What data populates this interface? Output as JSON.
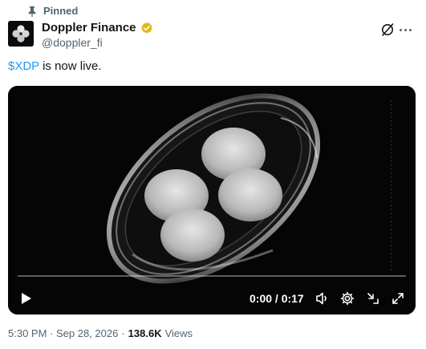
{
  "pinned_label": "Pinned",
  "author": {
    "display_name": "Doppler Finance",
    "handle": "@doppler_fi",
    "verified_badge_color": "#e2b719"
  },
  "tweet": {
    "cashtag": "$XDP",
    "text_rest": " is now live."
  },
  "video": {
    "time_display": "0:00 / 0:17",
    "progress": 0.0
  },
  "footer": {
    "timestamp": "5:30 PM · Sep 28, 2026",
    "separator": "·",
    "views_count": "138.6K",
    "views_label": "Views"
  },
  "colors": {
    "accent": "#1d9bf0",
    "muted": "#536471"
  },
  "icons": [
    "pin-icon",
    "verified-badge-icon",
    "grok-icon",
    "more-icon",
    "play-icon",
    "volume-icon",
    "settings-icon",
    "minimize-icon",
    "fullscreen-icon"
  ]
}
